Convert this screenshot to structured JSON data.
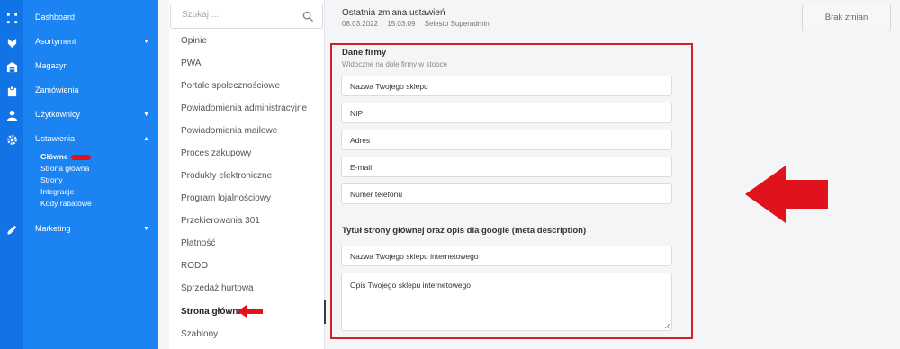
{
  "rail_icons": [
    "grid-icon",
    "assortment-icon",
    "warehouse-icon",
    "orders-icon",
    "users-icon",
    "gear-icon",
    "marketing-icon"
  ],
  "nav": {
    "items": [
      {
        "label": "Dashboard",
        "caret": ""
      },
      {
        "label": "Asortyment",
        "caret": "▼"
      },
      {
        "label": "Magazyn",
        "caret": ""
      },
      {
        "label": "Zamówienia",
        "caret": ""
      },
      {
        "label": "Użytkownicy",
        "caret": "▼"
      },
      {
        "label": "Ustawienia",
        "caret": "▲"
      },
      {
        "label": "Marketing",
        "caret": "▼"
      }
    ],
    "sub_items": [
      "Główne",
      "Strona główna",
      "Strony",
      "Integracje",
      "Kody rabatowe"
    ]
  },
  "search": {
    "placeholder": "Szukaj ..."
  },
  "settings_list": [
    "Opinie",
    "PWA",
    "Portale społecznościowe",
    "Powiadomienia administracyjne",
    "Powiadomienia mailowe",
    "Proces zakupowy",
    "Produkty elektroniczne",
    "Program lojalnościowy",
    "Przekierowania 301",
    "Płatność",
    "RODO",
    "Sprzedaż hurtowa",
    "Strona główna",
    "Szablony"
  ],
  "header": {
    "title": "Ostatnia zmiana ustawień",
    "date": "08.03.2022",
    "time": "15:03:09",
    "user": "Selesto Superadmin",
    "button": "Brak zmian"
  },
  "company": {
    "title": "Dane firmy",
    "subtitle": "Widoczne na dole firmy w stopce",
    "fields": [
      "Nazwa Twojego sklepu",
      "NIP",
      "Adres",
      "E-mail",
      "Numer telefonu"
    ]
  },
  "meta": {
    "title": "Tytuł strony głównej oraz opis dla google (meta description)",
    "name_field": "Nazwa Twojego sklepu internetowego",
    "description_field": "Opis Twojego sklepu internetowego"
  },
  "colors": {
    "rail": "#1273e6",
    "nav": "#1b84f2",
    "highlight": "#d21f2a"
  }
}
